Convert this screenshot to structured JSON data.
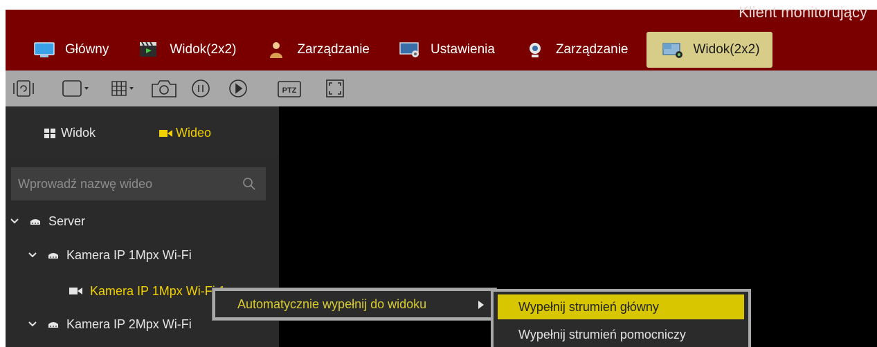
{
  "app": {
    "title": "Klient monitorujący"
  },
  "tabs": [
    {
      "label": "Główny",
      "icon": "monitor-icon"
    },
    {
      "label": "Widok(2x2)",
      "icon": "video-clip-icon"
    },
    {
      "label": "Zarządzanie",
      "icon": "user-icon"
    },
    {
      "label": "Ustawienia",
      "icon": "settings-screen-icon"
    },
    {
      "label": "Zarządzanie",
      "icon": "webcam-icon"
    },
    {
      "label": "Widok(2x2)",
      "icon": "camera-view-icon",
      "active": true
    }
  ],
  "toolbar": {
    "items": [
      "tour-icon",
      "single-window-icon",
      "layout-grid-icon",
      "snapshot-icon",
      "pause-all-icon",
      "play-all-icon",
      "ptz-icon",
      "fullscreen-icon"
    ],
    "ptz_label": "PTZ"
  },
  "sidebar": {
    "tabs": [
      {
        "label": "Widok",
        "active": false
      },
      {
        "label": "Wideo",
        "active": true
      }
    ],
    "search": {
      "placeholder": "Wprowadź nazwę wideo"
    },
    "tree": {
      "server": "Server",
      "device1": "Kamera IP 1Mpx Wi-Fi",
      "channel1": "Kamera IP 1Mpx Wi-Fi 1",
      "device2": "Kamera IP 2Mpx Wi-Fi"
    }
  },
  "context_menu": {
    "item": "Automatycznie wypełnij do widoku",
    "submenu": [
      {
        "label": "Wypełnij strumień główny",
        "selected": true
      },
      {
        "label": "Wypełnij strumień pomocniczy",
        "selected": false
      }
    ]
  },
  "colors": {
    "topbar": "#7a0000",
    "active_tab": "#d8cd88",
    "accent_yellow": "#d8c600",
    "panel_dark": "#2a2a2a",
    "video_bg": "#000000"
  }
}
